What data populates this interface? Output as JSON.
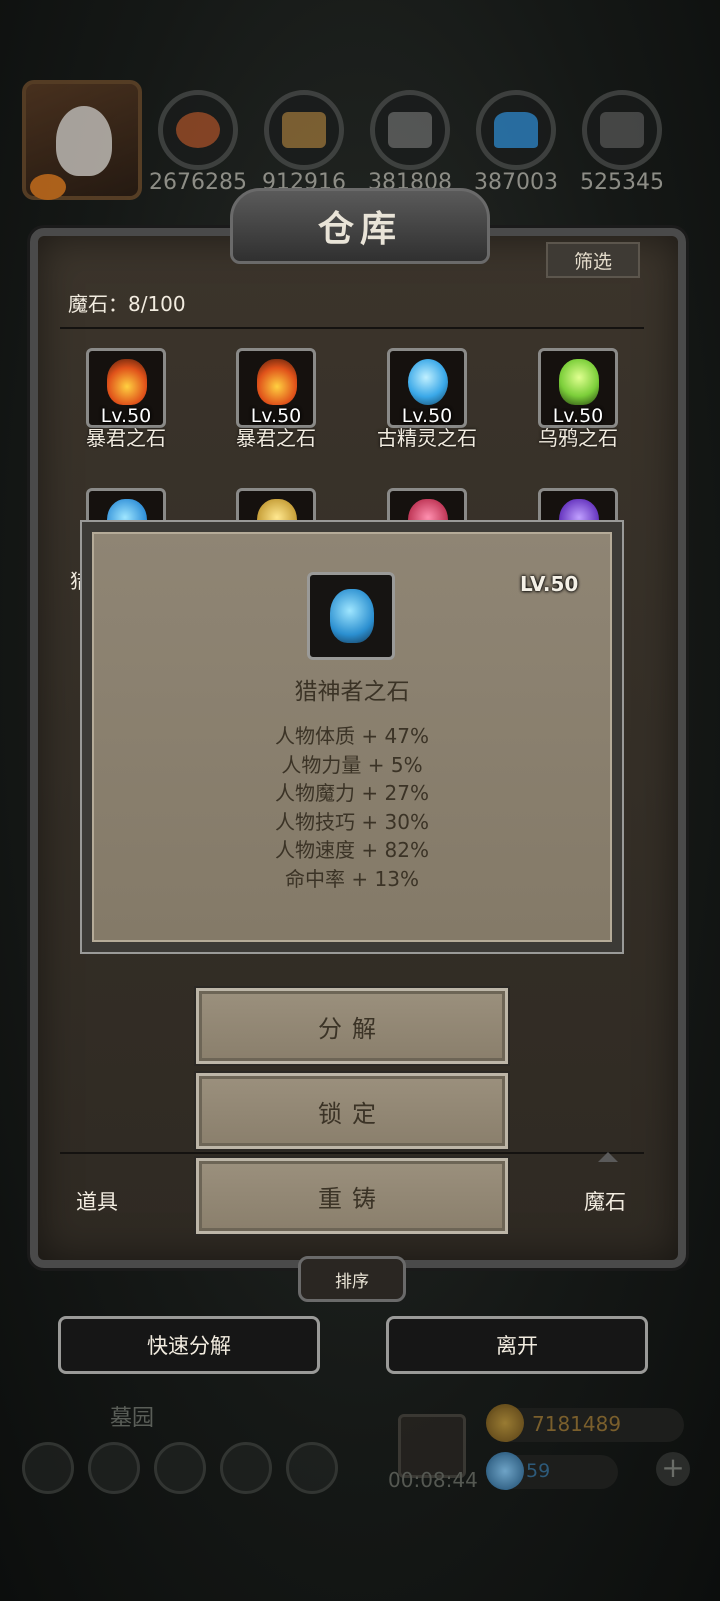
{
  "resources": [
    {
      "icon": "meat-icon",
      "value": "2676285",
      "color": "#b0542a"
    },
    {
      "icon": "wood-icon",
      "value": "912916",
      "color": "#a37a3c"
    },
    {
      "icon": "stone-icon",
      "value": "381808",
      "color": "#6d6d6d"
    },
    {
      "icon": "crystal-icon",
      "value": "387003",
      "color": "#2f8fd8"
    },
    {
      "icon": "iron-icon",
      "value": "525345",
      "color": "#5a5a5a"
    }
  ],
  "window": {
    "title": "仓库",
    "filter_label": "筛选",
    "count_label": "魔石：8/100"
  },
  "items": [
    {
      "name": "暴君之石",
      "level": "Lv.50",
      "color": "#e0521a"
    },
    {
      "name": "暴君之石",
      "level": "Lv.50",
      "color": "#e0521a"
    },
    {
      "name": "古精灵之石",
      "level": "Lv.50",
      "color": "#3aa8e8"
    },
    {
      "name": "乌鸦之石",
      "level": "Lv.50",
      "color": "#7ccf3a"
    },
    {
      "name": "猎",
      "level": "",
      "color": "#2f8fd8"
    },
    {
      "name": "",
      "level": "",
      "color": "#c9a23c"
    },
    {
      "name": "",
      "level": "",
      "color": "#c23a5a"
    },
    {
      "name": "",
      "level": "",
      "color": "#6a3ac2"
    }
  ],
  "tooltip": {
    "level": "LV.50",
    "name": "猎神者之石",
    "stats": [
      "人物体质 + 47%",
      "人物力量 + 5%",
      "人物魔力 + 27%",
      "人物技巧 + 30%",
      "人物速度 + 82%",
      "命中率 + 13%"
    ]
  },
  "actions": {
    "decompose": "分解",
    "lock": "锁定",
    "recast": "重铸"
  },
  "tabs": {
    "left": "道具",
    "right": "魔石"
  },
  "sort_label": "排序",
  "bottom": {
    "quick_decompose": "快速分解",
    "leave": "离开"
  },
  "hud": {
    "location": "墓园",
    "timer": "00:08:44",
    "gold": "7181489",
    "gems": "59"
  }
}
